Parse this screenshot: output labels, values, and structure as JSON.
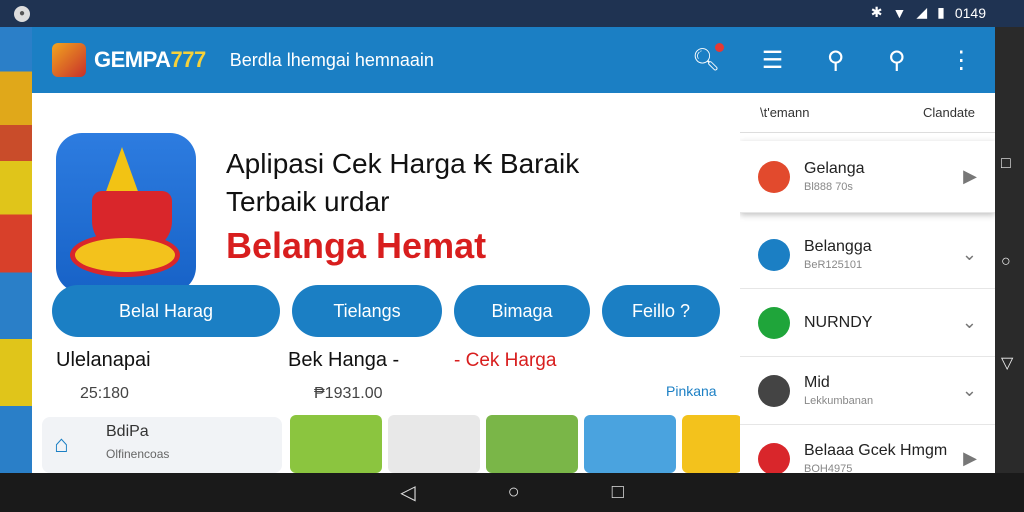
{
  "status": {
    "time": "0149",
    "left_icon": "notification-icon"
  },
  "appbar": {
    "brand_prefix": "GEMPA",
    "brand_suffix": "777",
    "tagline": "Berdla lhemgai hemnaain"
  },
  "hero": {
    "line1": "Aplipasi Cek Harga ₭ Baraik",
    "line2": "Terbaik urdar",
    "line3": "Belanga Hemat"
  },
  "pills": [
    "Belal Harag",
    "Tielangs",
    "Bimaga",
    "Feillo ?"
  ],
  "sections": {
    "left_title": "Ulelanapai",
    "left_value": "25:180",
    "mid_title": "Bek Hanga -",
    "mid_red": "- Cek Harga",
    "mid_value": "₱1931.00",
    "link": "Pinkana"
  },
  "bottom_card": {
    "title": "BdiPa",
    "sub": "Olfinencoas"
  },
  "panel": {
    "header_left": "\\t'emann",
    "header_right": "Clandate",
    "items": [
      {
        "title": "Gelanga",
        "sub": "Bl888 70s",
        "color": "#e24a2d"
      },
      {
        "title": "Belangga",
        "sub": "BeR125101",
        "color": "#1b7fc4"
      },
      {
        "title": "NURNDY",
        "sub": "",
        "color": "#1fa53a"
      },
      {
        "title": "Mid",
        "sub": "Lekkumbanan",
        "color": "#444444"
      },
      {
        "title": "Belaaa Gcek Hmgm",
        "sub": "BOH4975",
        "color": "#d9262b"
      }
    ]
  },
  "colors": {
    "primary": "#1b7fc4",
    "red": "#d81e1e"
  }
}
